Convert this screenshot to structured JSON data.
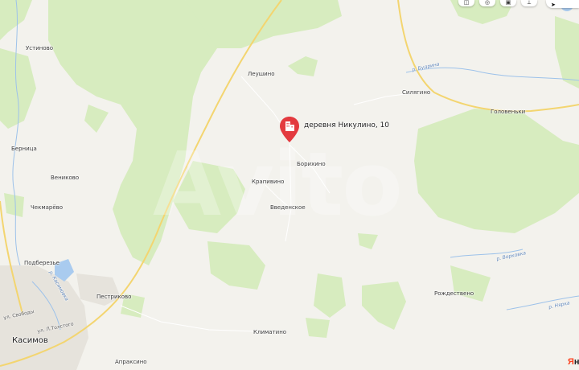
{
  "map": {
    "colors": {
      "land": "#f3f2ed",
      "forest": "#d7ecbf",
      "water": "#a9cbef",
      "city": "#e6e3dc",
      "road": "#f6d675",
      "marker": "#e33a3f"
    }
  },
  "marker": {
    "label": "деревня Никулино, 10",
    "icon": "building-icon"
  },
  "places": {
    "ustinovo": "Устиново",
    "leushino": "Леушино",
    "silyagino": "Силягино",
    "golovenki": "Головеньки",
    "bernitsa": "Берница",
    "borikhino": "Борихино",
    "venikovo": "Вениково",
    "krapivino": "Крапивино",
    "chekmarevo": "Чекмарёво",
    "vvedenskoe": "Введенское",
    "podberezye": "Подберезье",
    "pestrikovo": "Пестриково",
    "rozhdestveno": "Рождествено",
    "klimatino": "Климатино",
    "kasimov": "Касимов",
    "apraksino": "Апраксино"
  },
  "streets": {
    "svobody": "ул. Свободы",
    "l_tolstogo": "ул. Л.Толстого"
  },
  "rivers": {
    "budrina": "р. Будрина",
    "vorkovka": "р. Ворковка",
    "nyarka": "р. Нярка",
    "kasimovka": "р. Касимовка"
  },
  "controls": [
    "layers-icon",
    "traffic-icon",
    "panorama-icon",
    "ruler-icon"
  ],
  "watermark": "Avito",
  "logo": {
    "first": "Я",
    "rest": "н"
  }
}
